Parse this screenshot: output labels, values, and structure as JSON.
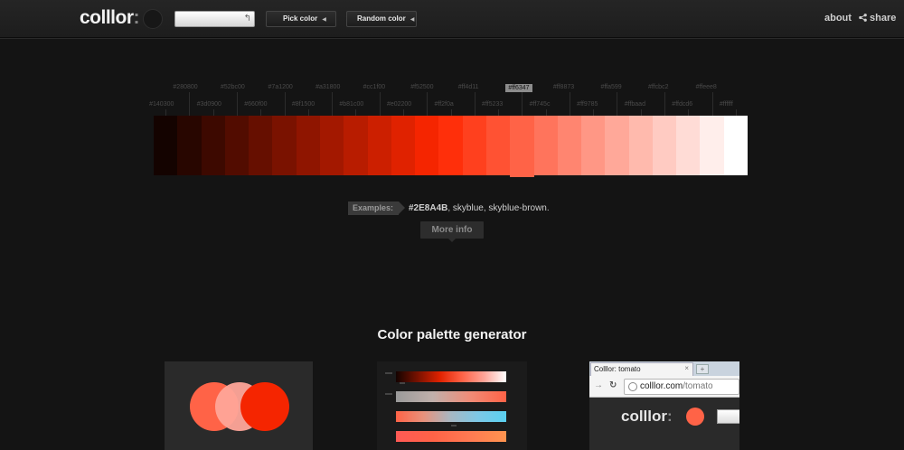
{
  "header": {
    "logo": "colllor",
    "logo_colon": ":",
    "search_value": "",
    "pick_color_label": "Pick color",
    "random_color_label": "Random color",
    "about_label": "about",
    "share_label": "share"
  },
  "ramp": {
    "selected": "#ff6347",
    "top_labels": [
      "#280800",
      "#52bc00",
      "#7a1200",
      "#a31800",
      "#cc1f00",
      "#f52500",
      "#ff4d11",
      "#ff6347",
      "#ff8873",
      "#ffa599",
      "#ffcbc2",
      "#ffeee8"
    ],
    "bottom_labels": [
      "#140300",
      "#3d0900",
      "#660f00",
      "#8f1500",
      "#b81c00",
      "#e02200",
      "#ff2f0a",
      "#ff5233",
      "#ff745c",
      "#ff9785",
      "#ffbaad",
      "#ffdcd6",
      "#ffffff"
    ],
    "swatches": [
      "#140300",
      "#280600",
      "#3d0900",
      "#520c00",
      "#660f00",
      "#7a1200",
      "#8f1500",
      "#a31800",
      "#b81c00",
      "#cc1f00",
      "#e02200",
      "#f52500",
      "#ff2f0a",
      "#ff401e",
      "#ff5233",
      "#ff6347",
      "#ff745c",
      "#ff8570",
      "#ff9785",
      "#ffa899",
      "#ffbaad",
      "#ffcbc2",
      "#ffdcd6",
      "#ffeeeb",
      "#ffffff"
    ]
  },
  "examples": {
    "tag": "Examples:",
    "items": [
      "#2E8A4B",
      "skyblue",
      "skyblue-brown"
    ],
    "sep": ",",
    "end": "."
  },
  "more_info": "More info",
  "section": {
    "title": "Color palette generator"
  },
  "thumb_palette": {
    "circles": [
      "#ff6347",
      "#ffa599",
      "#f52500"
    ]
  },
  "thumb_browser": {
    "tab_title": "Colllor: tomato",
    "tab_close": "×",
    "new_tab": "+",
    "url_domain": "colllor.com",
    "url_path": "/tomato",
    "logo": "colllor",
    "logo_colon": ":",
    "dot_color": "#ff6347"
  }
}
